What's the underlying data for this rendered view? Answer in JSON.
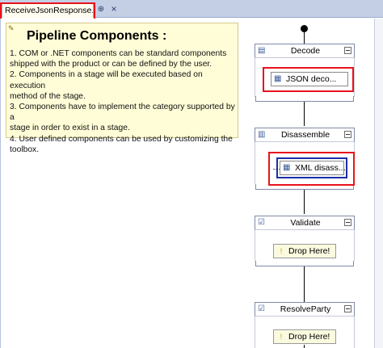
{
  "tab": {
    "title": "ReceiveJsonResponse.btp",
    "pin_glyph": "⊕",
    "close_glyph": "×"
  },
  "comment": {
    "title": "Pipeline Components :",
    "lines": [
      "1. COM or .NET components can be standard components",
      "shipped with the product or can be defined by the user.",
      "2. Components in a stage will be executed based on execution",
      "method of the stage.",
      "3. Components have to implement the category supported by a",
      "stage in order to exist in a stage.",
      "4. User defined components can be used by customizing the",
      "toolbox."
    ]
  },
  "stages": [
    {
      "label": "Decode",
      "icon": "decode-stage-icon",
      "component": "JSON deco..."
    },
    {
      "label": "Disassemble",
      "icon": "disassemble-stage-icon",
      "component": "XML disass..."
    },
    {
      "label": "Validate",
      "icon": "validate-stage-icon",
      "component": "Drop Here!"
    },
    {
      "label": "ResolveParty",
      "icon": "resolveparty-stage-icon",
      "component": "Drop Here!"
    }
  ],
  "colors": {
    "highlight_red": "#e8121c",
    "highlight_blue": "#1a2fa8",
    "tabbar": "#c4cfe6",
    "comment_bg": "#fffdd7"
  }
}
